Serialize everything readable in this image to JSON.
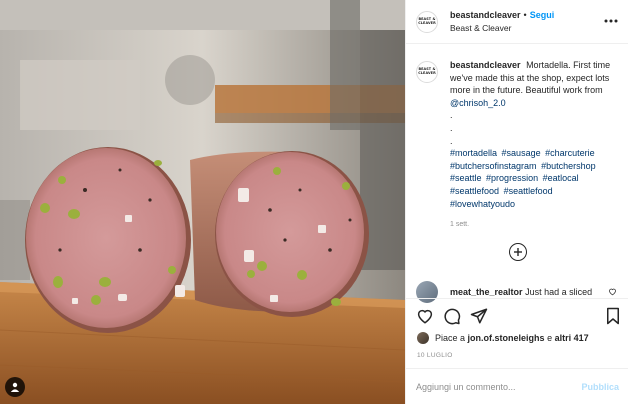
{
  "post": {
    "image_alt": "Mortadella photo",
    "account": {
      "username": "beastandcleaver",
      "display_name": "Beast & Cleaver",
      "follow_label": "Segui",
      "separator": "•",
      "avatar_text": "BEAST & CLEAVER"
    },
    "caption": {
      "username": "beastandcleaver",
      "text": "Mortadella. First time we've made this at the shop, expect lots more in the future. Beautiful work from",
      "mention": "@chrisoh_2.0",
      "dots": [
        ".",
        ".",
        "."
      ],
      "hashtags": [
        "#mortadella",
        "#sausage",
        "#charcuterie",
        "#butchersofinstagram",
        "#butchershop",
        "#seattle",
        "#progression",
        "#eatlocal",
        "#seattlefood",
        "#seattlefood",
        "#lovewhatyoudo"
      ],
      "time_ago": "1 sett."
    },
    "comments": [
      {
        "username": "meat_the_realtor",
        "text": "Just had a sliced"
      }
    ],
    "likes": {
      "prefix": "Piace a",
      "user": "jon.of.stoneleighs",
      "middle": "e",
      "others": "altri 417"
    },
    "date": "10 LUGLIO",
    "add_comment": {
      "placeholder": "Aggiungi un commento...",
      "publish_label": "Pubblica"
    }
  },
  "icons": {
    "more": "more-horizontal-icon",
    "load_more": "plus-circle-icon",
    "like": "heart-icon",
    "comment": "comment-icon",
    "share": "share-icon",
    "save": "bookmark-icon",
    "user_tag": "user-tag-icon"
  },
  "colors": {
    "link": "#00376b",
    "follow": "#0095f6",
    "publish_disabled": "#b2dffc",
    "muted": "#8e8e8e",
    "text": "#262626"
  }
}
